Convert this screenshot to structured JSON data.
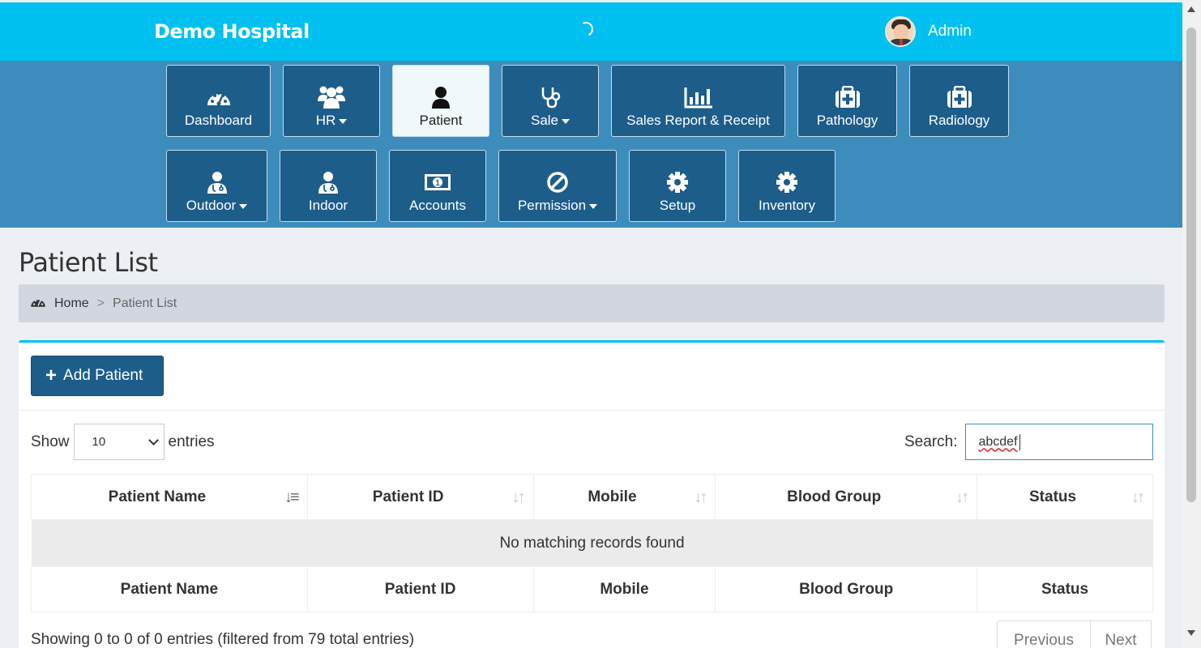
{
  "app": {
    "brand": "Demo Hospital",
    "user_name": "Admin"
  },
  "nav": {
    "dashboard": "Dashboard",
    "hr": "HR",
    "patient": "Patient",
    "sale": "Sale",
    "sales_report": "Sales Report & Receipt",
    "pathology": "Pathology",
    "radiology": "Radiology",
    "outdoor": "Outdoor",
    "indoor": "Indoor",
    "accounts": "Accounts",
    "permission": "Permission",
    "setup": "Setup",
    "inventory": "Inventory"
  },
  "page": {
    "title": "Patient List"
  },
  "breadcrumb": {
    "home": "Home",
    "separator": ">",
    "current": "Patient List"
  },
  "toolbar": {
    "add_label": "Add Patient"
  },
  "table_controls": {
    "show_label": "Show",
    "entries_value": "10",
    "entries_label": "entries",
    "search_label": "Search:",
    "search_value": "abcdef"
  },
  "table": {
    "columns": [
      "Patient Name",
      "Patient ID",
      "Mobile",
      "Blood Group",
      "Status"
    ],
    "empty_message": "No matching records found"
  },
  "footer": {
    "info": "Showing 0 to 0 of 0 entries (filtered from 79 total entries)",
    "previous": "Previous",
    "next": "Next"
  },
  "colors": {
    "topbar": "#00c0ef",
    "navarea": "#3c8dbc",
    "nav_button": "#1d5d8a",
    "active_nav": "#f0f8fb"
  }
}
